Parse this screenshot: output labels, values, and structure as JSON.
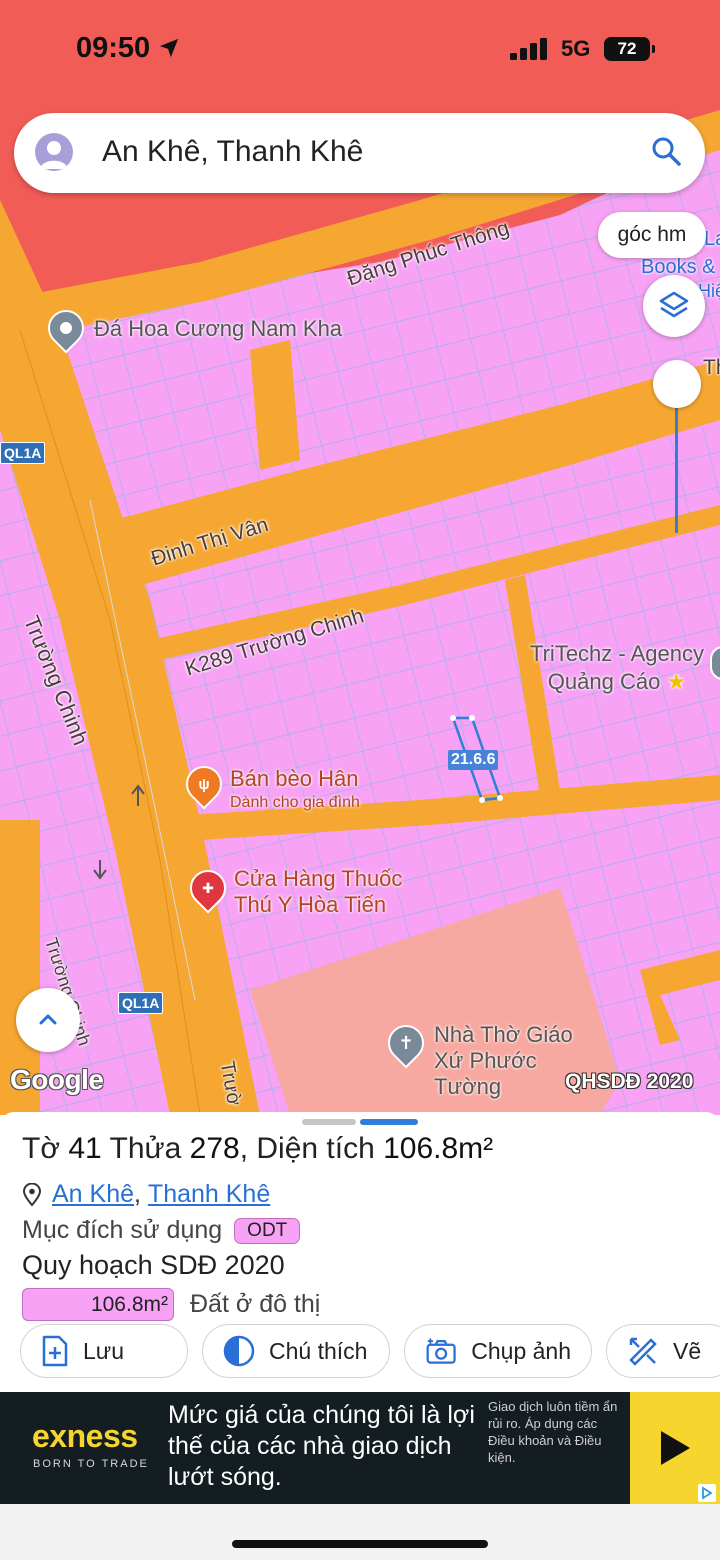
{
  "status_bar": {
    "time": "09:50",
    "network": "5G",
    "battery": "72"
  },
  "search": {
    "query": "An Khê, Thanh Khê"
  },
  "map": {
    "corner_button": "góc hm",
    "badge": "QHSDĐ 2020",
    "logo": "Google",
    "measurement": "21.6.6",
    "highway_shields": [
      "QL1A",
      "QL1A"
    ],
    "streets": [
      "Đặng Phúc Thông",
      "Đinh Thị Vân",
      "K289 Trường Chinh",
      "Trường Chinh",
      "Trường Chinh",
      "Trườ"
    ],
    "pois": [
      {
        "name": "Đá Hoa Cương Nam Kha",
        "subtitle": "",
        "icon": "place-pin-icon"
      },
      {
        "name": "TriTechz - Agency Quảng Cáo",
        "subtitle": "",
        "icon": "star-icon"
      },
      {
        "name": "Bán bèo Hân",
        "subtitle": "Dành cho gia đình",
        "icon": "restaurant-icon"
      },
      {
        "name": "Cửa Hàng Thuốc Thú Y Hòa Tiến",
        "subtitle": "",
        "icon": "pharmacy-icon"
      },
      {
        "name": "Nhà Thờ Giáo Xứ Phước Tường",
        "subtitle": "",
        "icon": "church-icon"
      }
    ],
    "edge_labels": [
      "Books &",
      "La",
      "Hiệ",
      "Th"
    ],
    "colors": {
      "residential": "#f7a2f4",
      "road": "#f5a731",
      "parcel_line": "#9fb3e8",
      "top_zone": "#f25c57",
      "salmon_zone": "#f7a8a0"
    }
  },
  "parcel": {
    "title_prefix": "Tờ",
    "sheet_no": "41",
    "plot_label": "Thửa",
    "plot_no": "278",
    "area_label": "Diện tích",
    "area": "106.8m²",
    "ward": "An Khê",
    "district": "Thanh Khê",
    "purpose_label": "Mục đích sử dụng",
    "purpose_code": "ODT",
    "plan_title": "Quy hoạch SDĐ 2020",
    "legend_area": "106.8m²",
    "legend_text": "Đất ở đô thị"
  },
  "actions": [
    {
      "label": "Lưu",
      "icon": "save-icon"
    },
    {
      "label": "Chú thích",
      "icon": "legend-icon"
    },
    {
      "label": "Chụp ảnh",
      "icon": "camera-icon"
    },
    {
      "label": "Vẽ",
      "icon": "draw-icon"
    }
  ],
  "ad": {
    "brand": "exness",
    "tagline": "BORN TO TRADE",
    "headline": "Mức giá của chúng tôi là lợi thế của các nhà giao dịch lướt sóng.",
    "disclaimer": "Giao dịch luôn tiềm ẩn rủi ro. Áp dụng các Điều khoản và Điều kiện.",
    "accent": "#f6d62e"
  }
}
